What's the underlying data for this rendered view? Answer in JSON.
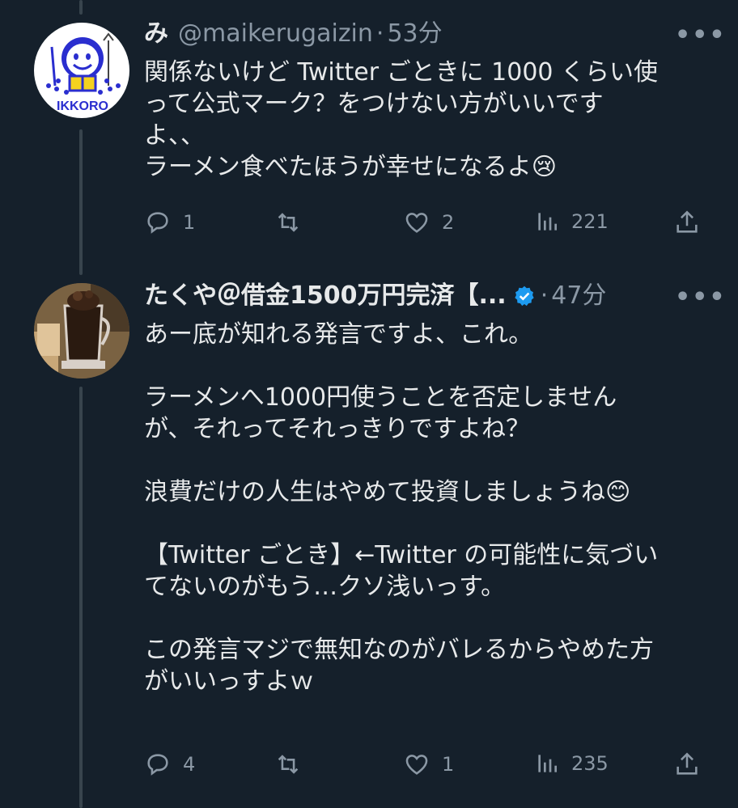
{
  "tweets": [
    {
      "name": "み",
      "handle": "@maikerugaizin",
      "separator": "·",
      "time": "53分",
      "avatar_text": "IKKORO",
      "body_lines": [
        "関係ないけど Twitter ごときに 1000 くらい使",
        "って公式マーク？をつけない方がいいです",
        "よ、、",
        "ラーメン食べたほうが幸せになるよ😢"
      ],
      "actions": {
        "replies": "1",
        "retweets": "",
        "likes": "2",
        "views": "221"
      },
      "icons": [
        "reply-icon",
        "retweet-icon",
        "like-icon",
        "views-icon",
        "share-icon"
      ]
    },
    {
      "name": "たくや＠借金1500万円完済【...",
      "handle": "",
      "separator": "·",
      "time": "47分",
      "verified": true,
      "body_lines": [
        "あー底が知れる発言ですよ、これ。",
        "",
        "ラーメンへ1000円使うことを否定しません",
        "が、それってそれっきりですよね？",
        "",
        "浪費だけの人生はやめて投資しましょうね😊",
        "",
        "【Twitter ごとき】←Twitter の可能性に気づい",
        "てないのがもう…クソ浅いっす。",
        "",
        "この発言マジで無知なのがバレるからやめた方",
        "がいいっすよｗ"
      ],
      "actions": {
        "replies": "4",
        "retweets": "",
        "likes": "1",
        "views": "235"
      },
      "icons": [
        "reply-icon",
        "retweet-icon",
        "like-icon",
        "views-icon",
        "share-icon"
      ]
    }
  ],
  "more_label": "•••",
  "colors": {
    "background": "#15202b",
    "secondary_text": "#8b98a5",
    "verified": "#1d9bf0",
    "thread_line": "#38444d"
  }
}
